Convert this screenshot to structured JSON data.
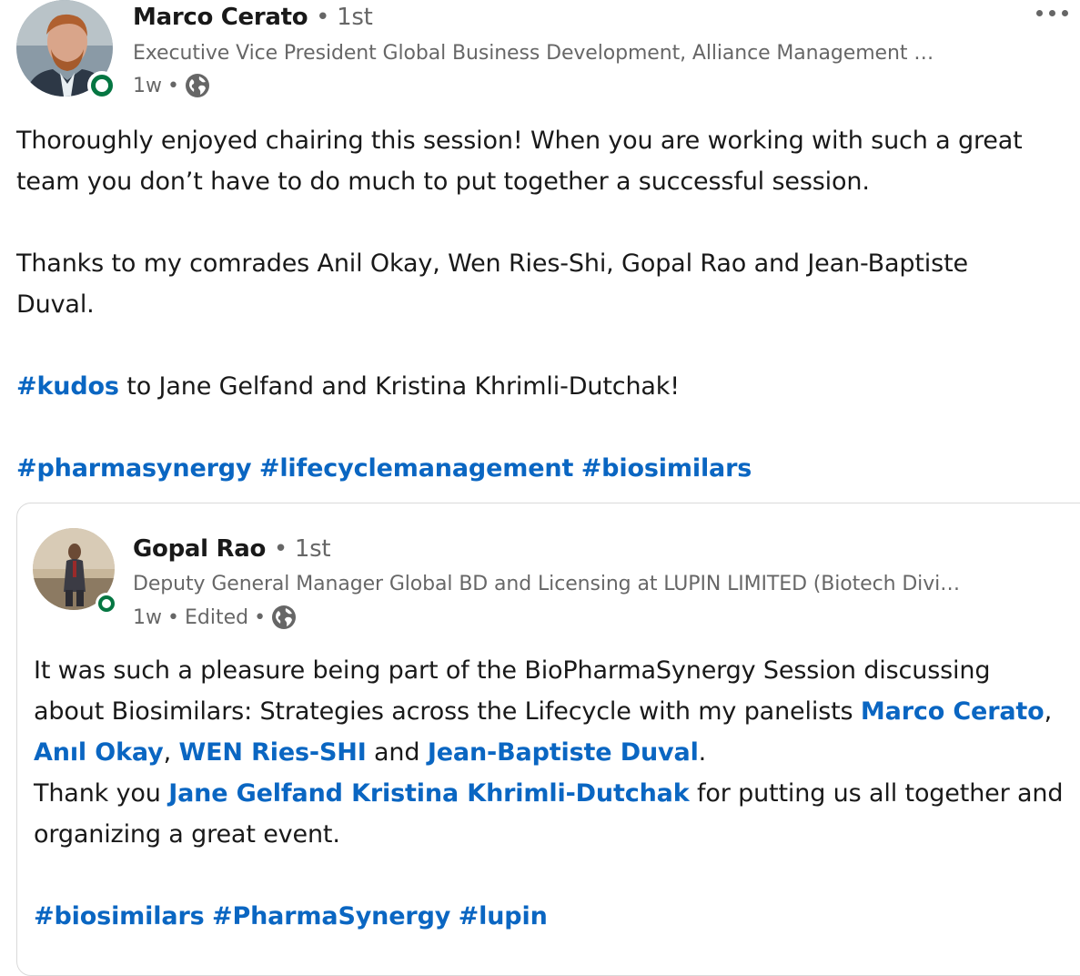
{
  "post": {
    "author": {
      "name": "Marco Cerato",
      "degree": "1st",
      "headline": "Executive Vice President Global Business Development, Alliance Management …",
      "time": "1w",
      "separator": "•",
      "visibility_icon": "globe-icon",
      "avatar_icon": "avatar-photo"
    },
    "more_icon": "ellipsis-icon",
    "body": {
      "line1": "Thoroughly enjoyed chairing this session! When you are working with such a great team you don’t have to do much to put together a successful session.",
      "line2": "Thanks to my comrades Anil Okay, Wen Ries-Shi, Gopal Rao and Jean-Baptiste Duval.",
      "kudos_tag": "#kudos",
      "kudos_text": " to Jane Gelfand and Kristina Khrimli-Dutchak!",
      "hashtags": [
        "#pharmasynergy",
        "#lifecyclemanagement",
        "#biosimilars"
      ]
    }
  },
  "reshared": {
    "author": {
      "name": "Gopal Rao",
      "degree": "1st",
      "headline": "Deputy General Manager Global BD and Licensing at LUPIN LIMITED (Biotech Divi…",
      "time": "1w",
      "edited": "Edited",
      "separator": "•",
      "visibility_icon": "globe-icon"
    },
    "body": {
      "p1_a": "It was such a pleasure being part of the BioPharmaSynergy Session discussing about Biosimilars: Strategies across the Lifecycle with my panelists ",
      "mention1": "Marco Cerato",
      "comma1": ", ",
      "mention2": "Anıl Okay",
      "comma2": ", ",
      "mention3": "WEN Ries-SHI",
      "and": " and ",
      "mention4": "Jean-Baptiste Duval",
      "period": ".",
      "p2_a": "Thank you ",
      "mention5": "Jane Gelfand Kristina Khrimli-Dutchak",
      "p2_b": " for putting us all together and organizing a great event.",
      "hashtags": [
        "#biosimilars",
        "#PharmaSynergy",
        "#lupin"
      ]
    }
  },
  "colors": {
    "link": "#0a66c2",
    "presence": "#057642",
    "border": "#d9d9d9"
  }
}
